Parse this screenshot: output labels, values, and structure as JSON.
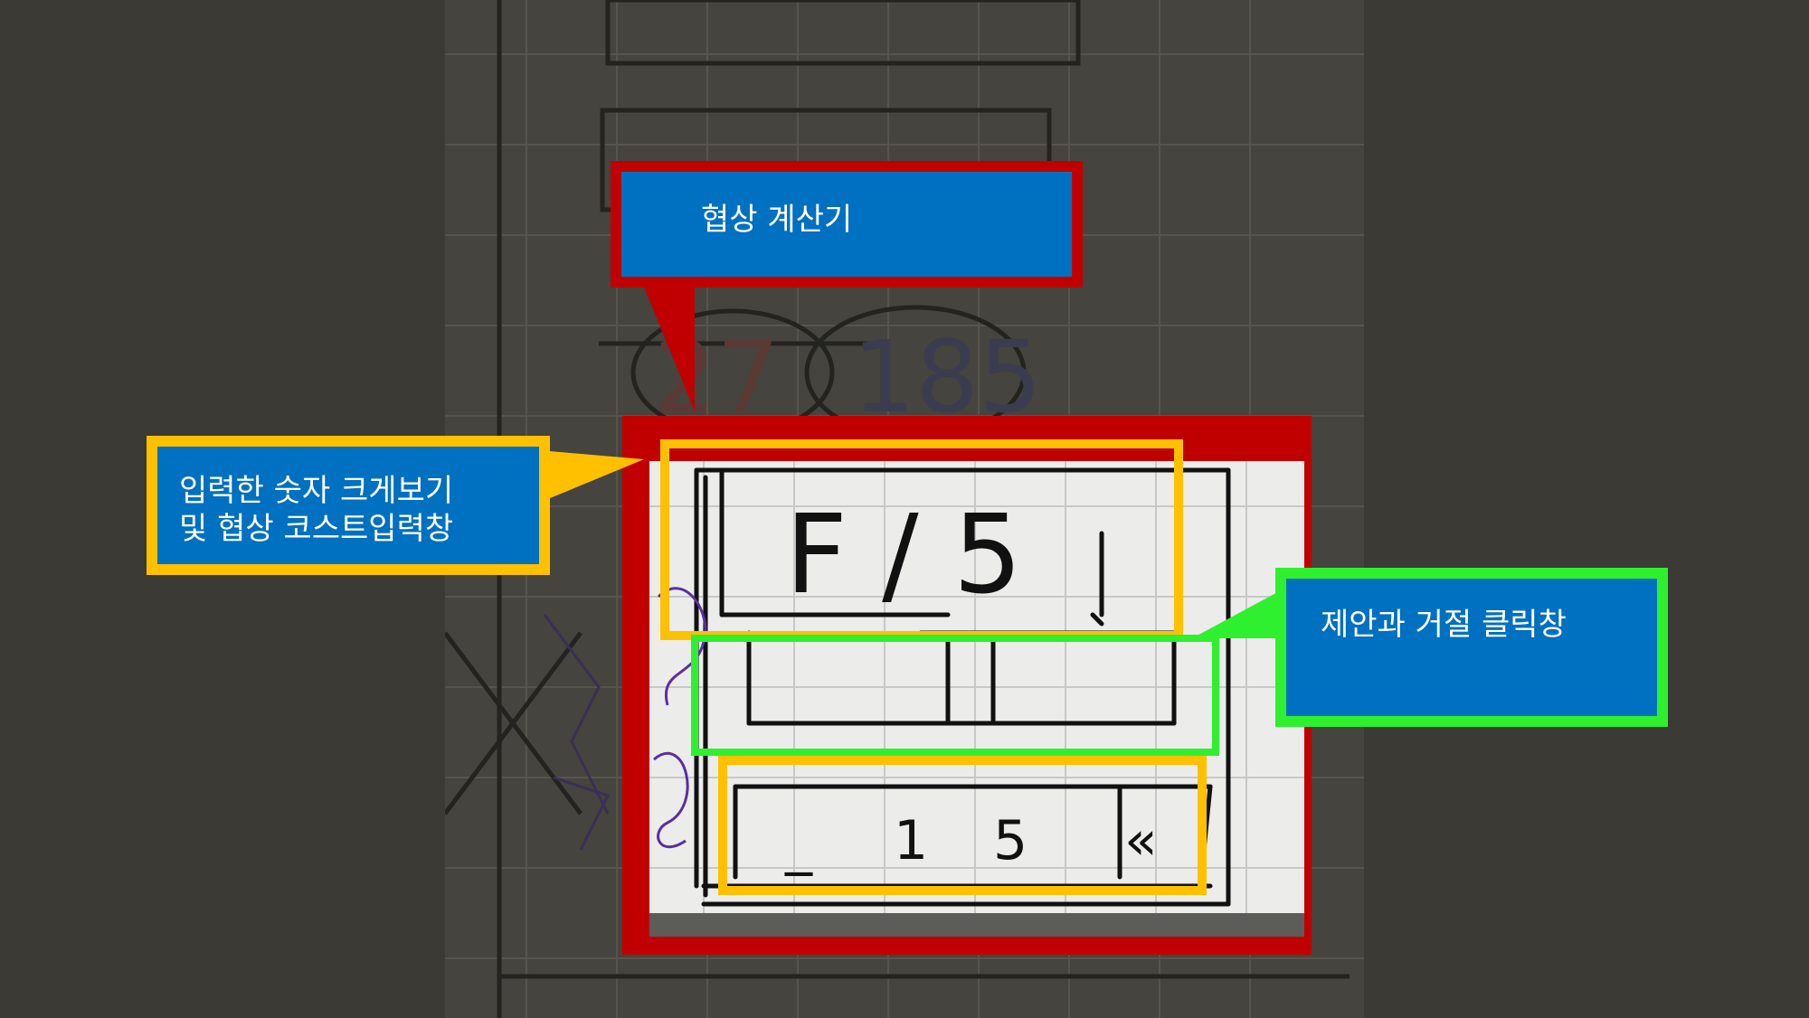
{
  "callouts": {
    "title": "협상 계산기",
    "display_input": "입력한 숫자 크게보기\n및 협상 코스트입력창",
    "accept_reject": "제안과 거절 클릭창"
  },
  "sketch": {
    "display_text": "F / 5",
    "keypad_keys": [
      "_",
      "1",
      "5",
      "«"
    ],
    "faded_numbers": [
      "27",
      "185"
    ]
  },
  "colors": {
    "callout_fill": "#0070c0",
    "frame_red": "#c00000",
    "highlight_yellow": "#ffc000",
    "highlight_green": "#2ff02f",
    "background": "#3b3a35"
  }
}
